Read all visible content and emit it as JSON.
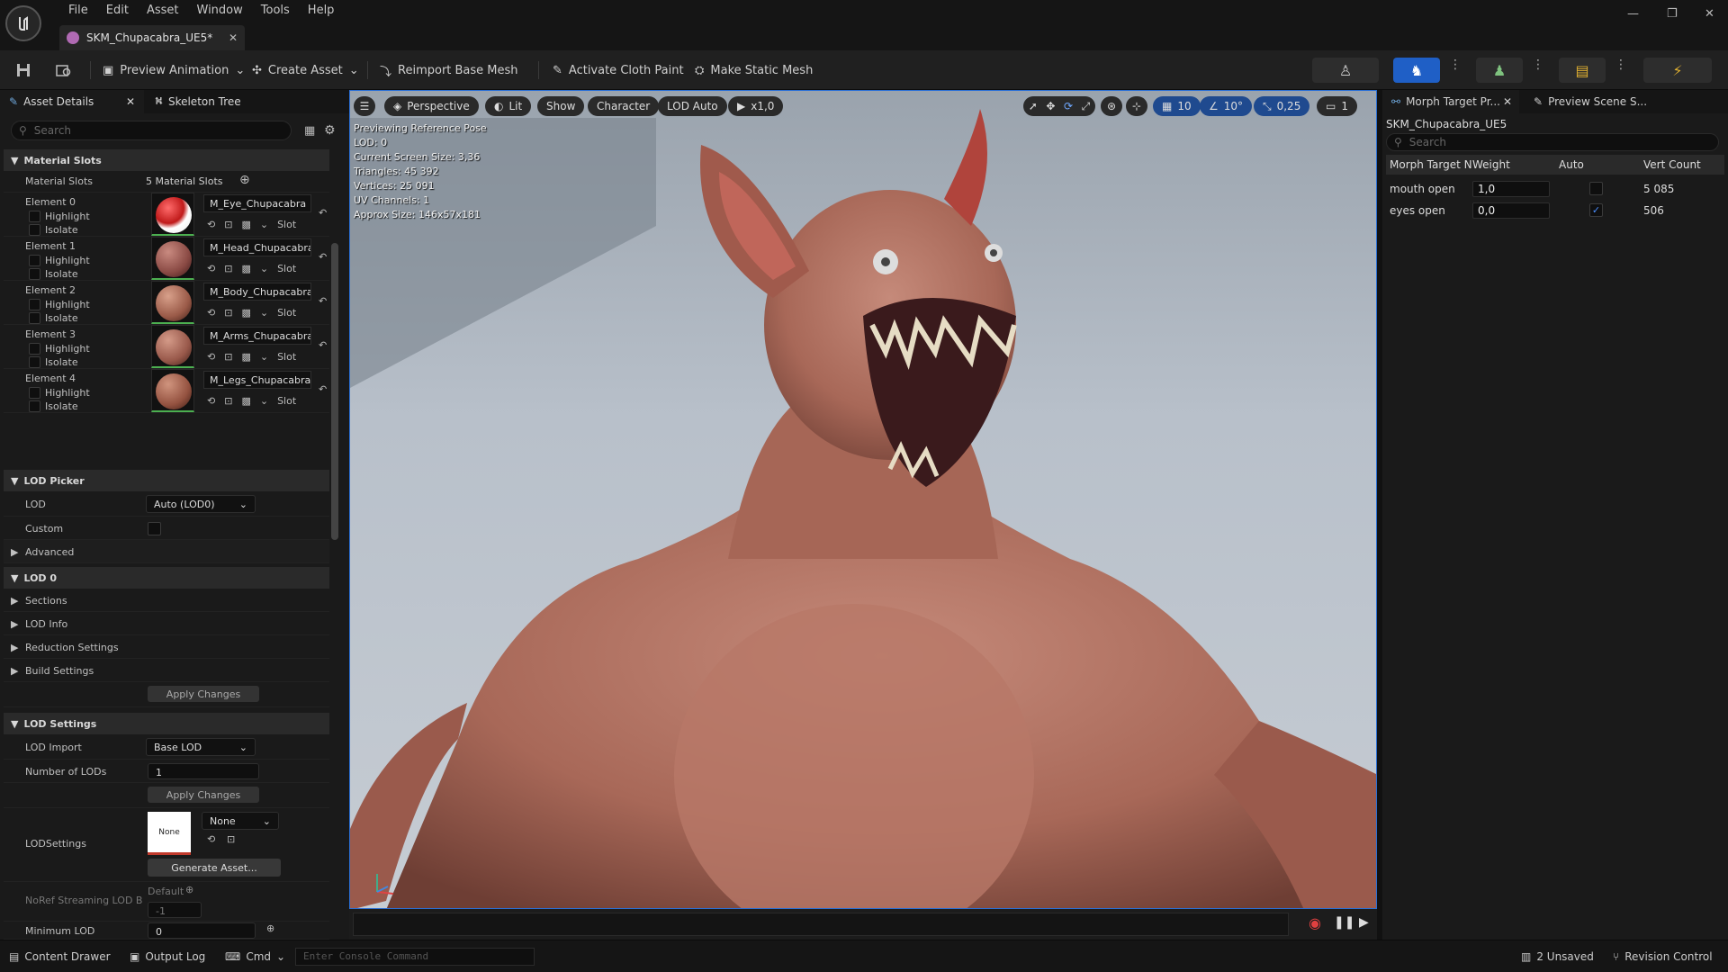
{
  "menu": [
    "File",
    "Edit",
    "Asset",
    "Window",
    "Tools",
    "Help"
  ],
  "document_tab": {
    "title": "SKM_Chupacabra_UE5*"
  },
  "toolbar": {
    "preview_animation": "Preview Animation",
    "create_asset": "Create Asset",
    "reimport_base_mesh": "Reimport Base Mesh",
    "activate_cloth_paint": "Activate Cloth Paint",
    "make_static_mesh": "Make Static Mesh"
  },
  "left_panel": {
    "tabs": [
      "Asset Details",
      "Skeleton Tree"
    ],
    "search_placeholder": "Search",
    "material_slots_header": "Material Slots",
    "material_slots_label": "Material Slots",
    "material_slots_count": "5 Material Slots",
    "elements": [
      {
        "label": "Element 0",
        "material": "M_Eye_Chupacabra",
        "highlight": "Highlight",
        "isolate": "Isolate",
        "slot": "Slot"
      },
      {
        "label": "Element 1",
        "material": "M_Head_Chupacabra",
        "highlight": "Highlight",
        "isolate": "Isolate",
        "slot": "Slot"
      },
      {
        "label": "Element 2",
        "material": "M_Body_Chupacabra",
        "highlight": "Highlight",
        "isolate": "Isolate",
        "slot": "Slot"
      },
      {
        "label": "Element 3",
        "material": "M_Arms_Chupacabra",
        "highlight": "Highlight",
        "isolate": "Isolate",
        "slot": "Slot"
      },
      {
        "label": "Element 4",
        "material": "M_Legs_Chupacabra",
        "highlight": "Highlight",
        "isolate": "Isolate",
        "slot": "Slot"
      }
    ],
    "lod_picker_header": "LOD Picker",
    "lod_label": "LOD",
    "lod_value": "Auto (LOD0)",
    "custom_label": "Custom",
    "advanced_label": "Advanced",
    "lod0_header": "LOD 0",
    "sections_label": "Sections",
    "lod_info_label": "LOD Info",
    "reduction_settings_label": "Reduction Settings",
    "build_settings_label": "Build Settings",
    "apply_changes": "Apply Changes",
    "lod_settings_header": "LOD Settings",
    "lod_import_label": "LOD Import",
    "lod_import_value": "Base LOD",
    "num_lods_label": "Number of LODs",
    "num_lods_value": "1",
    "lodsettings_label": "LODSettings",
    "lodsettings_thumb": "None",
    "lodsettings_value": "None",
    "generate_asset": "Generate Asset...",
    "default_label": "Default",
    "noref_label": "NoRef Streaming LOD B",
    "noref_value": "-1",
    "min_lod_label": "Minimum LOD",
    "min_lod_value": "0"
  },
  "viewport": {
    "perspective": "Perspective",
    "lit": "Lit",
    "show": "Show",
    "character": "Character",
    "lod_auto": "LOD Auto",
    "play_speed": "x1,0",
    "grid_snap": "10",
    "rot_snap": "10°",
    "scale_snap": "0,25",
    "camera_speed": "1",
    "info": [
      "Previewing Reference Pose",
      "LOD: 0",
      "Current Screen Size: 3,36",
      "Triangles: 45 392",
      "Vertices: 25 091",
      "UV Channels: 1",
      "Approx Size: 146x57x181"
    ]
  },
  "right_panel": {
    "tabs": [
      "Morph Target Pr...",
      "Preview Scene S..."
    ],
    "asset_name": "SKM_Chupacabra_UE5",
    "search_placeholder": "Search",
    "columns": [
      "Morph Target N",
      "Weight",
      "Auto",
      "Vert Count"
    ],
    "rows": [
      {
        "name": "mouth open",
        "weight": "1,0",
        "auto": false,
        "verts": "5 085"
      },
      {
        "name": "eyes open",
        "weight": "0,0",
        "auto": true,
        "verts": "506"
      }
    ]
  },
  "statusbar": {
    "content_drawer": "Content Drawer",
    "output_log": "Output Log",
    "cmd": "Cmd",
    "console_placeholder": "Enter Console Command",
    "unsaved": "2 Unsaved",
    "revision_control": "Revision Control"
  },
  "colors": {
    "accent": "#2a6fd6",
    "bg": "#1a1a1a",
    "panel_header": "#2a2a2a"
  }
}
